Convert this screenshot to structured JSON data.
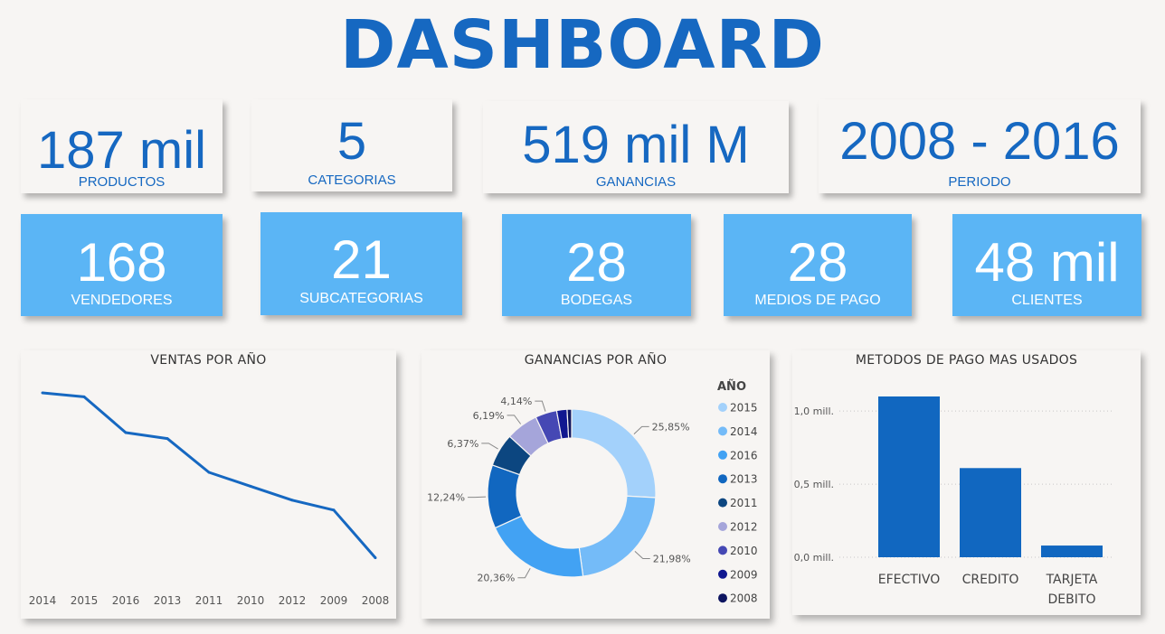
{
  "header": {
    "title": "DASHBOARD"
  },
  "kpis_top": [
    {
      "value": "187 mil",
      "label": "PRODUCTOS"
    },
    {
      "value": "5",
      "label": "CATEGORIAS"
    },
    {
      "value": "519 mil M",
      "label": "GANANCIAS"
    },
    {
      "value": "2008 - 2016",
      "label": "PERIODO"
    }
  ],
  "kpis_bottom": [
    {
      "value": "168",
      "label": "VENDEDORES"
    },
    {
      "value": "21",
      "label": "SUBCATEGORIAS"
    },
    {
      "value": "28",
      "label": "BODEGAS"
    },
    {
      "value": "28",
      "label": "MEDIOS DE PAGO"
    },
    {
      "value": "48 mil",
      "label": "CLIENTES"
    }
  ],
  "colors": {
    "accent": "#1668c1",
    "kpi_blue": "#5bb5f5",
    "background": "#f7f5f3"
  },
  "chart_data": [
    {
      "type": "line",
      "title": "VENTAS POR AÑO",
      "categories": [
        "2014",
        "2015",
        "2016",
        "2013",
        "2011",
        "2010",
        "2012",
        "2009",
        "2008"
      ],
      "values": [
        100,
        98,
        80,
        77,
        60,
        53,
        46,
        41,
        17
      ],
      "ylim": [
        0,
        105
      ],
      "grid": false,
      "color": "#1668c1"
    },
    {
      "type": "pie",
      "title": "GANANCIAS POR AÑO",
      "legend_title": "AÑO",
      "legend_position": "right",
      "slices": [
        {
          "name": "2015",
          "value": 25.85,
          "label": "25,85%",
          "color": "#a3d1fb"
        },
        {
          "name": "2014",
          "value": 21.98,
          "label": "21,98%",
          "color": "#74bbf8"
        },
        {
          "name": "2016",
          "value": 20.36,
          "label": "20,36%",
          "color": "#42a2f3"
        },
        {
          "name": "2013",
          "value": 12.24,
          "label": "12,24%",
          "color": "#1167c0"
        },
        {
          "name": "2011",
          "value": 6.37,
          "label": "6,37%",
          "color": "#0c4680"
        },
        {
          "name": "2012",
          "value": 6.19,
          "label": "6,19%",
          "color": "#a5a5da"
        },
        {
          "name": "2010",
          "value": 4.14,
          "label": "4,14%",
          "color": "#4548b4"
        },
        {
          "name": "2009",
          "value": 2.0,
          "label": "",
          "color": "#101790"
        },
        {
          "name": "2008",
          "value": 0.87,
          "label": "",
          "color": "#0e1560"
        }
      ]
    },
    {
      "type": "bar",
      "title": "METODOS DE PAGO MAS USADOS",
      "categories": [
        "EFECTIVO",
        "CREDITO",
        "TARJETA DEBITO"
      ],
      "values": [
        1.1,
        0.61,
        0.08
      ],
      "unit": "mill.",
      "ylim": [
        0,
        1.1
      ],
      "yticks": [
        0.0,
        0.5,
        1.0
      ],
      "ytick_labels": [
        "0,0 mill.",
        "0,5 mill.",
        "1,0 mill."
      ],
      "grid": true,
      "color": "#1167c0"
    }
  ]
}
